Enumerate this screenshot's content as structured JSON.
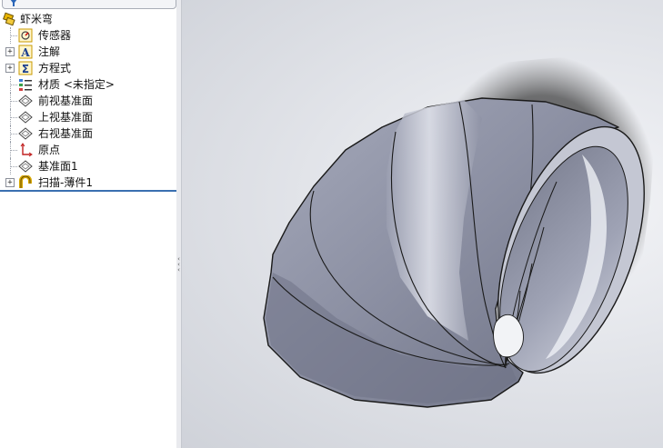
{
  "feature_tree": {
    "part_name": "虾米弯",
    "items": [
      {
        "label": "传感器",
        "icon": "sensor-icon",
        "expandable": false
      },
      {
        "label": "注解",
        "icon": "annotation-icon",
        "expandable": true
      },
      {
        "label": "方程式",
        "icon": "equation-icon",
        "expandable": true
      },
      {
        "label": "材质 <未指定>",
        "icon": "material-icon",
        "expandable": false
      },
      {
        "label": "前视基准面",
        "icon": "plane-icon",
        "expandable": false
      },
      {
        "label": "上视基准面",
        "icon": "plane-icon",
        "expandable": false
      },
      {
        "label": "右视基准面",
        "icon": "plane-icon",
        "expandable": false
      },
      {
        "label": "原点",
        "icon": "origin-icon",
        "expandable": false
      },
      {
        "label": "基准面1",
        "icon": "plane-icon",
        "expandable": false
      },
      {
        "label": "扫描-薄件1",
        "icon": "sweep-thin-icon",
        "expandable": true
      }
    ]
  },
  "colors": {
    "accent_divider": "#3a6fb0",
    "model_body": "#8f93a6",
    "model_dark": "#5e6273",
    "model_highlight": "#c9ccd8",
    "shadow": "#3c3c3c"
  }
}
